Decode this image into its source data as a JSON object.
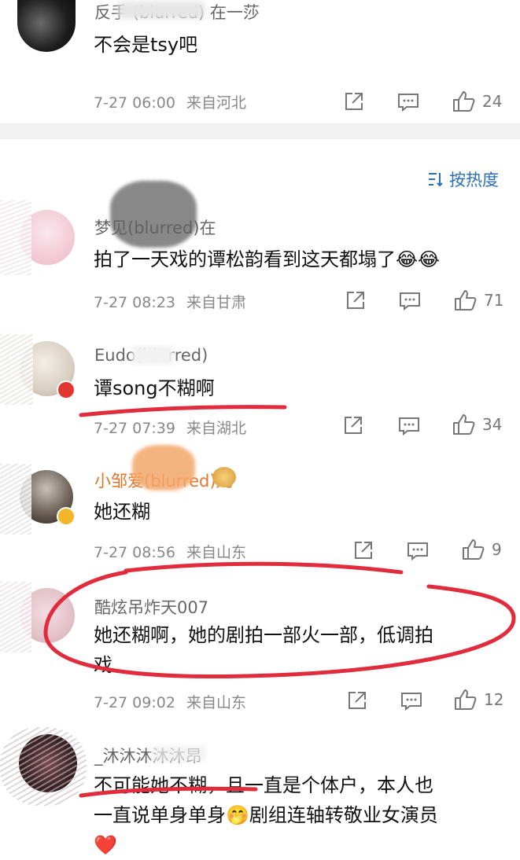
{
  "sort_label": "按热度",
  "sort_icon": "sort-lines-icon",
  "colors": {
    "brand": "#2a6fb4",
    "highlight": "#e02c3c",
    "meta": "#888888",
    "divider": "#f1f1f1"
  },
  "comments": [
    {
      "name": "反手 (blurred) 在一莎",
      "text": "不会是tsy吧",
      "time": "7-27 06:00",
      "location": "来自河北",
      "likes": "24"
    },
    {
      "name": "梦见(blurred)在",
      "text": "拍了一天戏的谭松韵看到这天都塌了",
      "emoji": "😂😂",
      "time": "7-27 08:23",
      "location": "来自甘肃",
      "likes": "71"
    },
    {
      "name": "Eudo(blurred)",
      "text": "谭song不糊啊",
      "time": "7-27 07:39",
      "location": "来自湖北",
      "likes": "34"
    },
    {
      "name": "小邹爱(blurred)儿",
      "text": "她还糊",
      "time": "7-27 08:56",
      "location": "来自山东",
      "likes": "9"
    },
    {
      "name": "酷炫吊炸天007",
      "text_line1": "她还糊啊，她的剧拍一部火一部，低调拍",
      "text_line2": "戏",
      "time": "7-27 09:02",
      "location": "来自山东",
      "likes": "12"
    },
    {
      "name": "_沐沐沐沐沐昂",
      "text_line1": "不可能她不糊，且一直是个体户，本人也",
      "text_line2a": "一直说单身单身",
      "emoji2": "🤭",
      "text_line2b": "剧组连轴转敬业女演员",
      "text_line3": "❤️"
    }
  ]
}
